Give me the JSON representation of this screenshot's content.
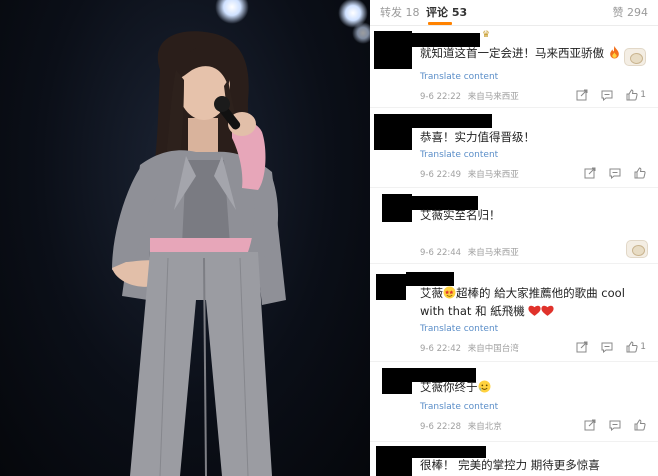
{
  "tabs": {
    "repost": "转发 18",
    "comments": "评论 53",
    "likes": "赞 294"
  },
  "translate_label": "Translate content",
  "comments": [
    {
      "text": "就知道这首一定会进！马来西亚骄傲",
      "time": "9-6 22:22",
      "location": "来自马来西亚",
      "likes": "1"
    },
    {
      "text": "恭喜！实力值得晋级！",
      "time": "9-6 22:49",
      "location": "来自马来西亚",
      "likes": ""
    },
    {
      "text": "艾薇实至名归！",
      "time": "9-6 22:44",
      "location": "来自马来西亚",
      "likes": ""
    },
    {
      "text_a": "艾薇",
      "text_b": "超棒的 給大家推薦他的歌曲 cool",
      "text_c": "with that 和 紙飛機",
      "time": "9-6 22:42",
      "location": "来自中国台湾",
      "likes": "1"
    },
    {
      "text": "艾薇你终于",
      "time": "9-6 22:28",
      "location": "来自北京",
      "likes": ""
    },
    {
      "text": "很棒！ 完美的掌控力 期待更多惊喜"
    }
  ],
  "icons": [
    "repost-icon",
    "comment-icon",
    "like-icon",
    "fire-emoji",
    "heart-emoji",
    "smile-emoji",
    "star-face-emoji",
    "crown-icon"
  ],
  "colors": {
    "accent": "#ff8200",
    "link": "#5b8ec8",
    "heart": "#e0322b"
  }
}
